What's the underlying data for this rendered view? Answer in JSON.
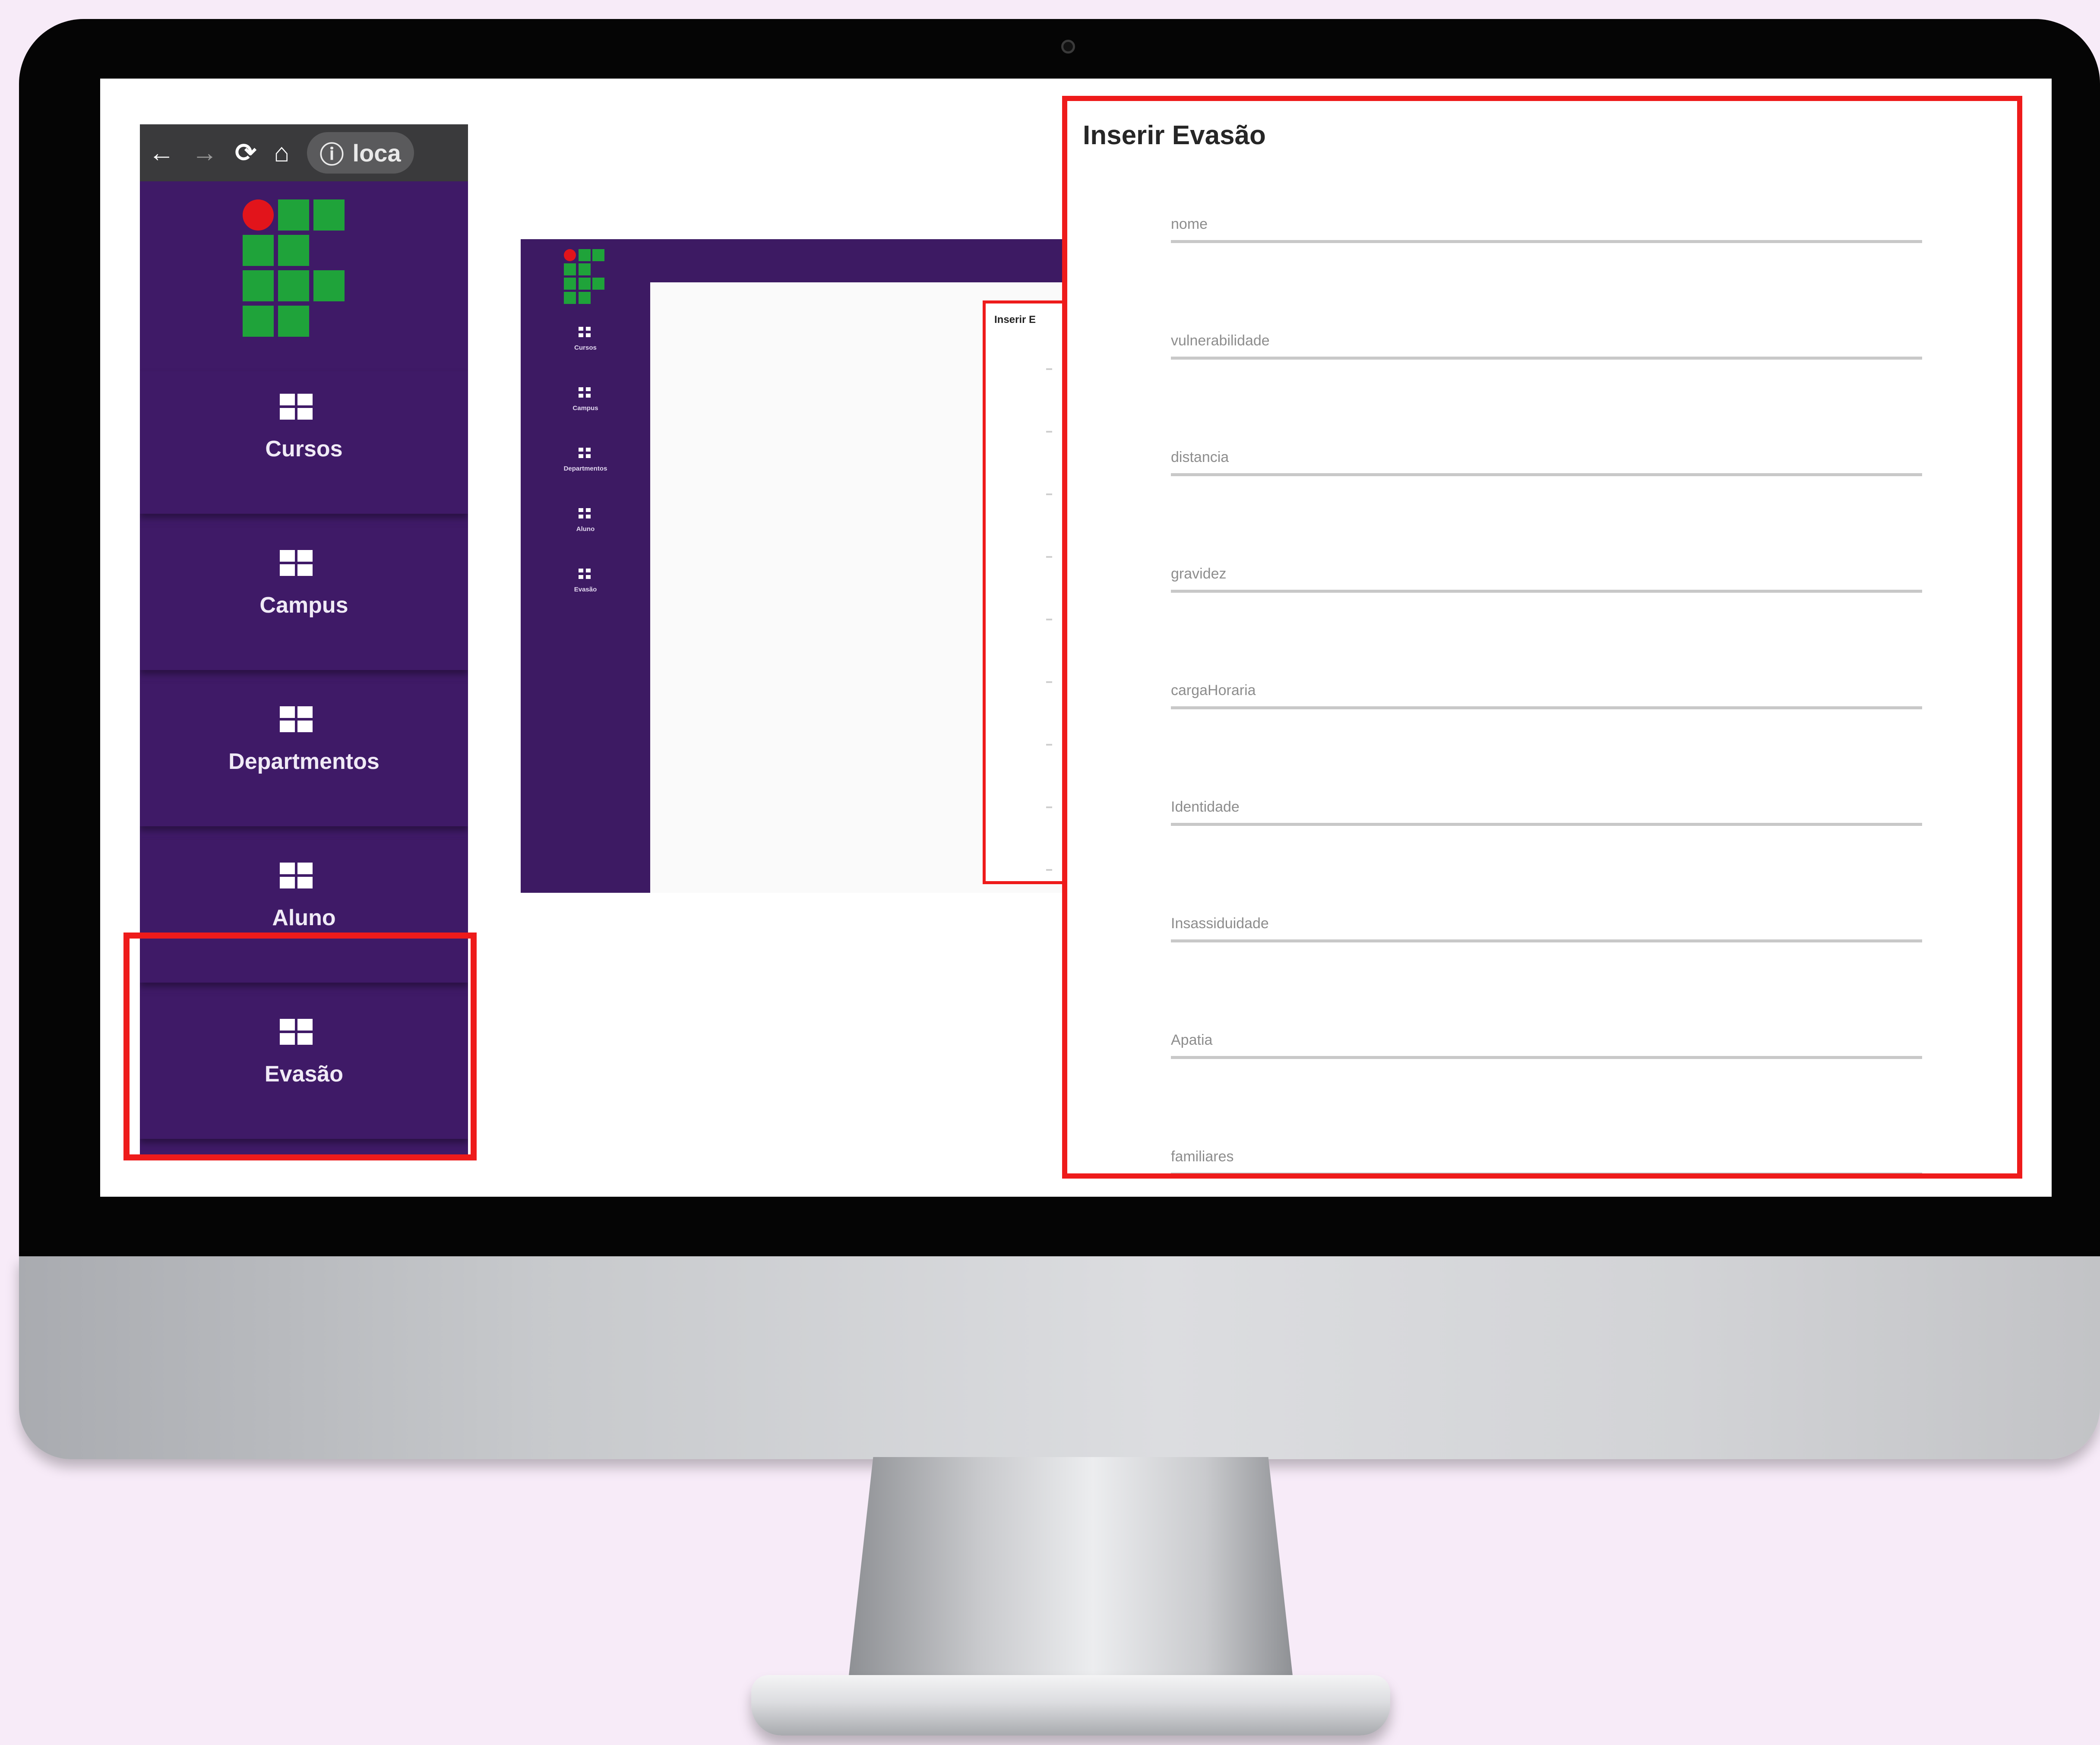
{
  "browser": {
    "back_icon": "arrow-left-icon",
    "forward_icon": "arrow-right-icon",
    "reload_icon": "reload-icon",
    "home_icon": "home-icon",
    "url_text": "loca"
  },
  "sidebar": {
    "items": [
      {
        "label": "Cursos",
        "icon": "dashboard-icon"
      },
      {
        "label": "Campus",
        "icon": "dashboard-icon"
      },
      {
        "label": "Departmentos",
        "icon": "dashboard-icon"
      },
      {
        "label": "Aluno",
        "icon": "dashboard-icon"
      },
      {
        "label": "Evasão",
        "icon": "dashboard-icon"
      }
    ]
  },
  "thumbnail": {
    "items": [
      "Cursos",
      "Campus",
      "Departmentos",
      "Aluno",
      "Evasão"
    ],
    "form_title": "Inserir E"
  },
  "form": {
    "title": "Inserir Evasão",
    "fields": [
      "nome",
      "vulnerabilidade",
      "distancia",
      "gravidez",
      "cargaHoraria",
      "Identidade",
      "Insassiduidade",
      "Apatia",
      "familiares"
    ]
  },
  "colors": {
    "sidebar": "#3f1a67",
    "highlight": "#ee1b1b",
    "logo_green": "#1fa33a",
    "logo_red": "#e2141b",
    "background": "#f7ebf8"
  }
}
